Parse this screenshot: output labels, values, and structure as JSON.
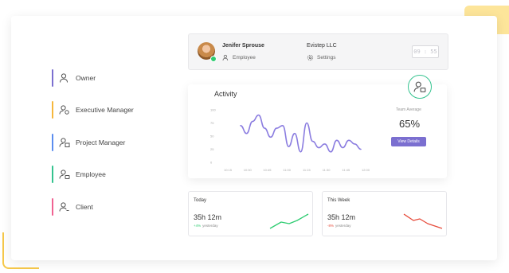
{
  "roles": [
    {
      "label": "Owner",
      "color": "#7b6fd0"
    },
    {
      "label": "Executive Manager",
      "color": "#f6b73c"
    },
    {
      "label": "Project Manager",
      "color": "#5b8def"
    },
    {
      "label": "Employee",
      "color": "#34c38f"
    },
    {
      "label": "Client",
      "color": "#f06292"
    }
  ],
  "user": {
    "name": "Jenifer Sprouse",
    "role": "Employee",
    "company": "Evistep LLC",
    "settings_label": "Settings",
    "timer": "09 : 55"
  },
  "activity": {
    "title": "Activity",
    "team_average_label": "Team Average",
    "team_average_value": "65%",
    "view_details_label": "View Details"
  },
  "chart_data": {
    "type": "line",
    "title": "Activity",
    "x": [
      "10:15",
      "10:30",
      "10:45",
      "11:00",
      "11:15",
      "11:30",
      "11:45",
      "12:00"
    ],
    "y_ticks": [
      0,
      25,
      50,
      75,
      100
    ],
    "ylim": [
      0,
      100
    ],
    "values": [
      70,
      55,
      78,
      90,
      65,
      48,
      65,
      70,
      30,
      55,
      20,
      75,
      40,
      28,
      35,
      20,
      42,
      28,
      42,
      35,
      25
    ],
    "line_color": "#8b7de0",
    "grid": false
  },
  "today": {
    "title": "Today",
    "value": "35h 12m",
    "change": "+4%",
    "vs_label": "yesterday",
    "pill": "",
    "trend_color": "#2ecc71"
  },
  "week": {
    "title": "This Week",
    "value": "35h 12m",
    "change": "-8%",
    "vs_label": "yesterday",
    "pill": "",
    "trend_color": "#e74c3c"
  }
}
